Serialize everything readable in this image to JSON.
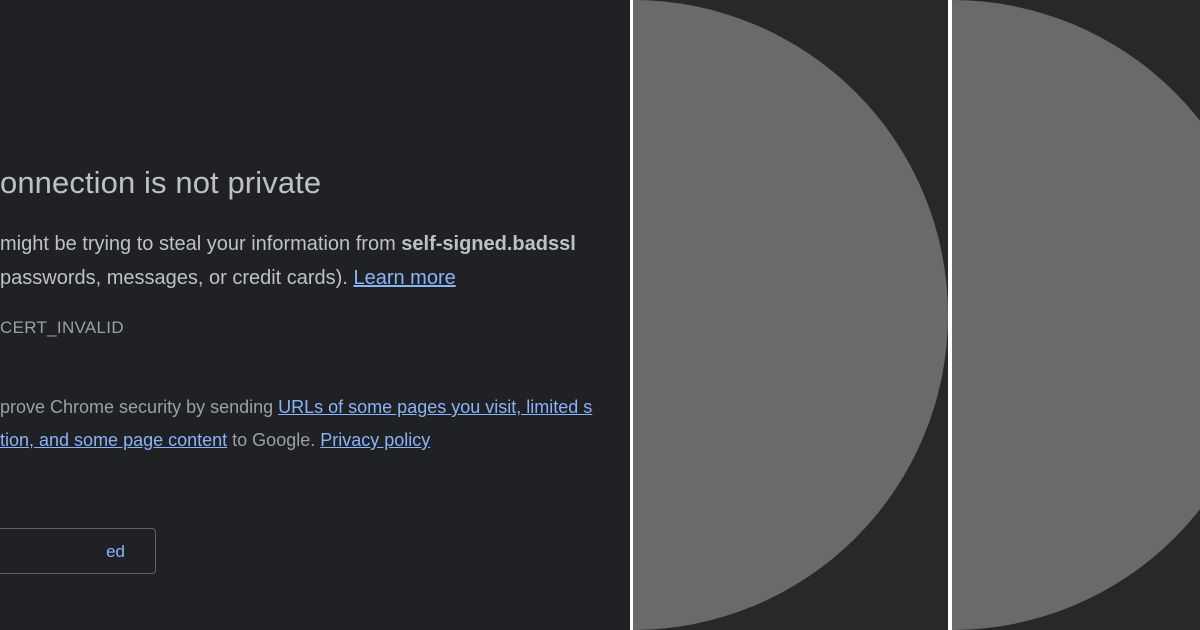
{
  "interstitial": {
    "heading": "onnection is not private",
    "para1": {
      "text": "might be trying to steal your information from ",
      "domain": "self-signed.badssl"
    },
    "para2": {
      "text": "passwords, messages, or credit cards). ",
      "link": "Learn more"
    },
    "error_code": "CERT_INVALID",
    "optin_line1": {
      "text": "prove Chrome security by sending ",
      "link": "URLs of some pages you visit, limited s"
    },
    "optin_line2": {
      "link1": "tion, and some page content",
      "text": " to Google. ",
      "link2": "Privacy policy"
    },
    "advanced_label": "ed"
  },
  "colors": {
    "page_background": "#202124",
    "link": "#8ab4f8",
    "placeholder_panel": "#282828",
    "placeholder_shape": "#6a6a6a"
  }
}
